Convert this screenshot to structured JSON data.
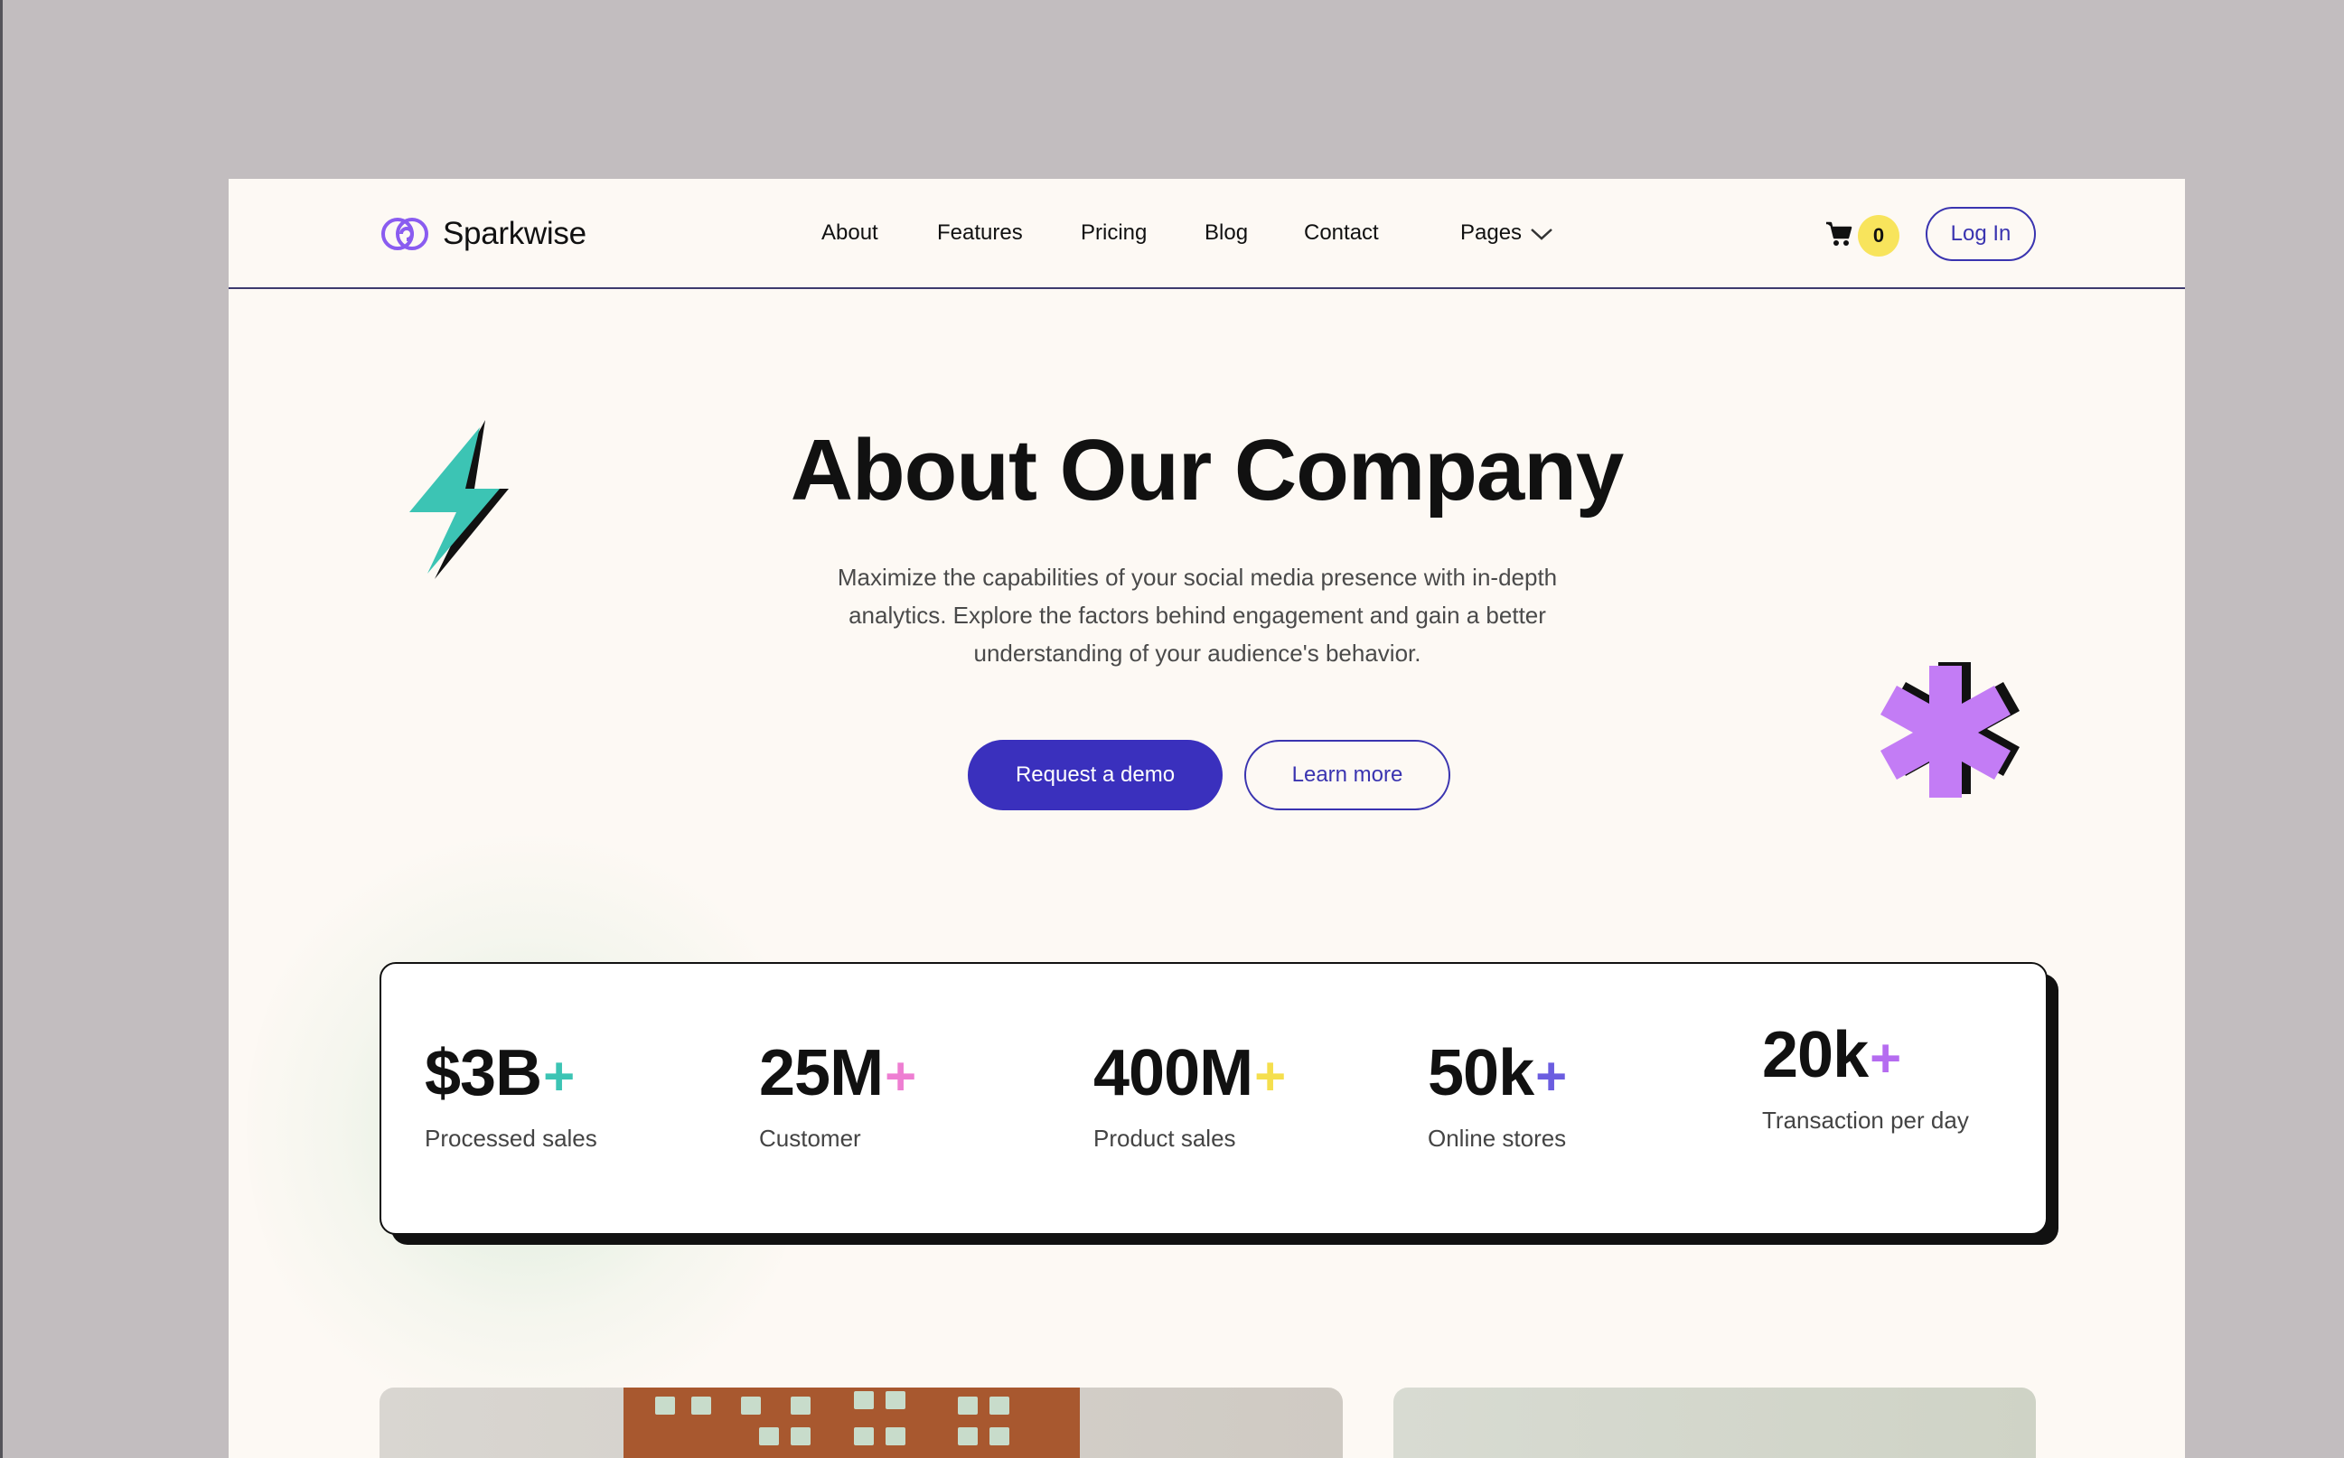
{
  "nav": {
    "brand": "Sparkwise",
    "links": [
      "About",
      "Features",
      "Pricing",
      "Blog",
      "Contact",
      "Pages"
    ],
    "cart_count": "0",
    "login": "Log In"
  },
  "hero": {
    "title": "About Our Company",
    "subtitle_lines": [
      "Maximize the capabilities of your social media presence with in-depth",
      "analytics. Explore the factors behind engagement and gain a better",
      "understanding of your audience's behavior."
    ],
    "primary_cta": "Request a demo",
    "secondary_cta": "Learn more"
  },
  "stats": [
    {
      "value": "$3B",
      "plus": "+",
      "label": "Processed sales",
      "plus_color": "#3cc4b4"
    },
    {
      "value": "25M",
      "plus": "+",
      "label": "Customer",
      "plus_color": "#ee7ed2"
    },
    {
      "value": "400M",
      "plus": "+",
      "label": "Product sales",
      "plus_color": "#f5df4d"
    },
    {
      "value": "50k",
      "plus": "+",
      "label": "Online stores",
      "plus_color": "#6b5de0"
    },
    {
      "value": "20k",
      "plus": "+",
      "label": "Transaction per day",
      "plus_color": "#b56cf0"
    }
  ],
  "colors": {
    "accent": "#3a30bd",
    "bolt": "#3cc4b4",
    "asterisk": "#c37cf5",
    "badge": "#f8e45c",
    "background": "#fdf9f4"
  },
  "icons": [
    "sparkwise-logo-icon",
    "cart-icon",
    "chevron-down-icon",
    "lightning-bolt-icon",
    "asterisk-icon"
  ]
}
